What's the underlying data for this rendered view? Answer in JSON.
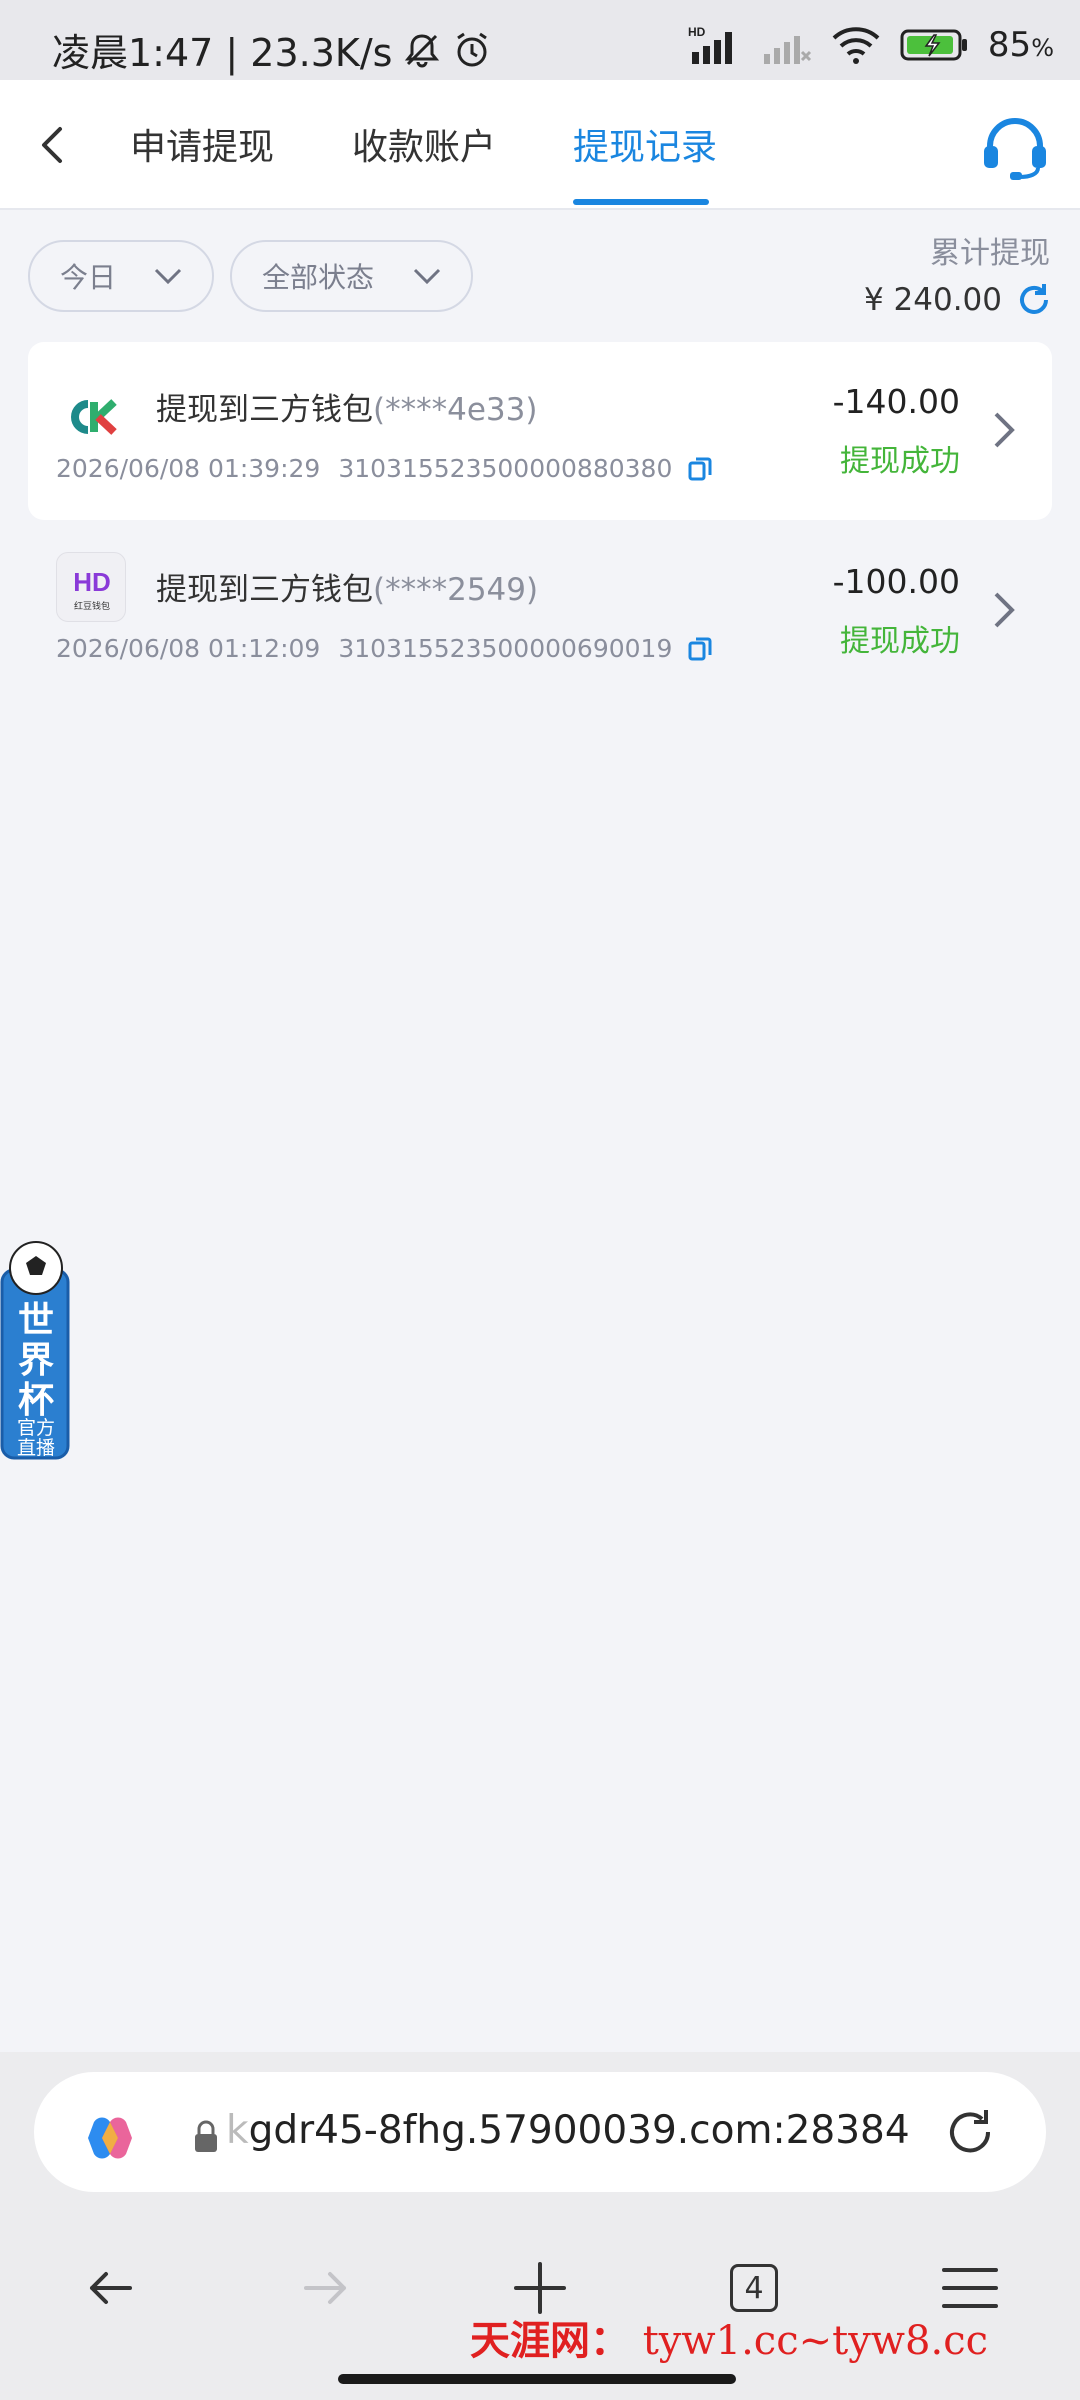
{
  "status_bar": {
    "time_speed": "凌晨1:47 | 23.3K/s",
    "network_label": "HD",
    "battery": "85",
    "battery_unit": "%"
  },
  "header": {
    "tabs": [
      {
        "label": "申请提现"
      },
      {
        "label": "收款账户"
      },
      {
        "label": "提现记录"
      }
    ],
    "active_tab_index": 2
  },
  "filters": {
    "date": "今日",
    "status": "全部状态"
  },
  "total": {
    "label": "累计提现",
    "value": "¥ 240.00"
  },
  "records": [
    {
      "logo": "ck-logo",
      "title": "提现到三方钱包",
      "masked_account": "(****4e33)",
      "datetime": "2026/06/08 01:39:29",
      "order_no": "310315523500000880380",
      "amount": "-140.00",
      "status": "提现成功"
    },
    {
      "logo": "hd-logo",
      "logo_caption": "红豆钱包",
      "title": "提现到三方钱包",
      "masked_account": "(****2549)",
      "datetime": "2026/06/08 01:12:09",
      "order_no": "310315523500000690019",
      "amount": "-100.00",
      "status": "提现成功"
    }
  ],
  "floating_badge": {
    "line1": "世",
    "line2": "界",
    "line3": "杯",
    "sub1": "官方",
    "sub2": "直播"
  },
  "browser": {
    "url_prefix": "k",
    "url": "gdr45-8fhg.57900039.com:28384",
    "tab_count": "4"
  },
  "watermark": {
    "site_name": "天涯网：",
    "urls": "tyw1.cc~tyw8.cc"
  },
  "colors": {
    "accent": "#1a86e0",
    "success": "#44b53a",
    "background": "#f3f4f8"
  }
}
